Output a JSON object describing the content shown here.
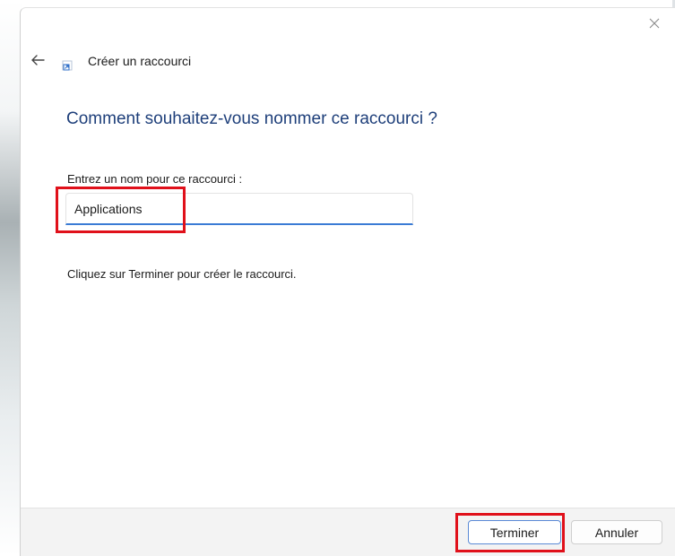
{
  "header": {
    "title": "Créer un raccourci"
  },
  "main": {
    "heading": "Comment souhaitez-vous nommer ce raccourci ?",
    "name_label": "Entrez un nom pour ce raccourci :",
    "name_value": "Applications",
    "info_text": "Cliquez sur Terminer pour créer le raccourci."
  },
  "footer": {
    "finish_label": "Terminer",
    "cancel_label": "Annuler"
  },
  "icons": {
    "close": "close-icon",
    "back": "back-arrow-icon",
    "shortcut": "shortcut-icon"
  },
  "colors": {
    "heading": "#1e3f7a",
    "accent": "#3a7bd5",
    "highlight": "#e0101a"
  }
}
